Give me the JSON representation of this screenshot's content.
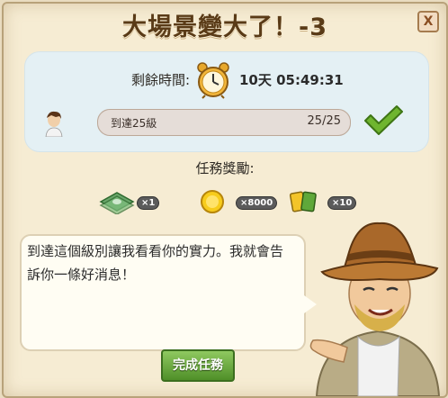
{
  "dialog": {
    "title": "大場景變大了！-3",
    "close_label": "X"
  },
  "timer": {
    "label": "剩餘時間:",
    "value": "10天 05:49:31"
  },
  "task": {
    "label": "到達25級",
    "count": "25/25",
    "progress_fraction": 1.0
  },
  "rewards": {
    "title": "任務獎勵:",
    "items": [
      {
        "icon": "cash-icon",
        "count": "×1"
      },
      {
        "icon": "coin-icon",
        "count": "×8000"
      },
      {
        "icon": "xp-card-icon",
        "count": "×10"
      }
    ]
  },
  "speech": {
    "text": "到達這個級別讓我看看你的實力。我就會告訴你一條好消息！"
  },
  "buttons": {
    "complete_label": "完成任務"
  },
  "colors": {
    "accent_green": "#4f8f28",
    "panel_blue": "#e4f0f4",
    "parchment": "#f6ecd3"
  }
}
